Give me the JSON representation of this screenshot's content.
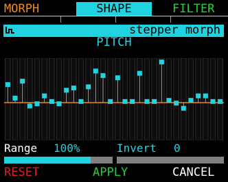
{
  "tabs": {
    "morph": "MORPH",
    "shape": "SHAPE",
    "filter": "FILTER"
  },
  "preset": {
    "icon": "waveform-icon",
    "name": "stepper morph"
  },
  "param_title": "PITCH",
  "graph": {
    "baseline_color": "#f28a1e",
    "stem_color": "#a0a0a0",
    "point_color": "#1fd4e0",
    "steps": [
      0.8,
      0.2,
      0.95,
      -0.15,
      -0.05,
      0.3,
      0.05,
      -0.05,
      0.55,
      0.65,
      0.05,
      0.7,
      1.4,
      1.2,
      0.05,
      1.1,
      0.05,
      0.05,
      1.3,
      0.05,
      0.05,
      1.8,
      0.1,
      -0.02,
      -0.25,
      0.1,
      0.3,
      0.3,
      0.05,
      0.05
    ]
  },
  "range": {
    "label": "Range",
    "value": "100%",
    "level": 0.8
  },
  "invert": {
    "label": "Invert",
    "value": "0",
    "level": 0
  },
  "buttons": {
    "reset": "RESET",
    "apply": "APPLY",
    "cancel": "CANCEL"
  },
  "colors": {
    "accent": "#1fd4e0",
    "morph": "#f28a1e",
    "filter": "#22d33a",
    "reset": "#e02020",
    "apply": "#22d33a"
  }
}
